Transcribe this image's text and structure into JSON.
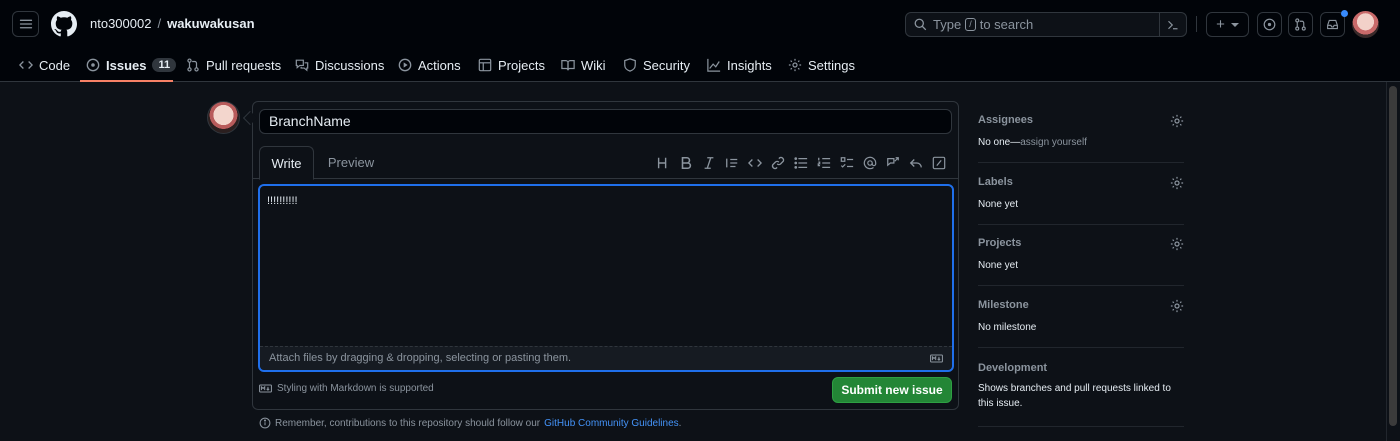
{
  "header": {
    "owner": "nto300002",
    "separator": "/",
    "repo": "wakuwakusan",
    "search_prefix": "Type",
    "search_key": "/",
    "search_suffix": "to search",
    "plus_label": "+"
  },
  "repo_nav": {
    "tabs": [
      {
        "label": "Code"
      },
      {
        "label": "Issues",
        "count": "11"
      },
      {
        "label": "Pull requests"
      },
      {
        "label": "Discussions"
      },
      {
        "label": "Actions"
      },
      {
        "label": "Projects"
      },
      {
        "label": "Wiki"
      },
      {
        "label": "Security"
      },
      {
        "label": "Insights"
      },
      {
        "label": "Settings"
      }
    ]
  },
  "issue_form": {
    "title_value": "BranchName",
    "write_tab": "Write",
    "preview_tab": "Preview",
    "body_value": "!!!!!!!!!!",
    "attach_text": "Attach files by dragging & dropping, selecting or pasting them.",
    "markdown_note": "Styling with Markdown is supported",
    "submit_label": "Submit new issue",
    "remember_text": "Remember, contributions to this repository should follow our",
    "guidelines_link": "GitHub Community Guidelines",
    "guidelines_tail": "."
  },
  "sidebar": {
    "assignees": {
      "heading": "Assignees",
      "value": "No one—",
      "link": "assign yourself"
    },
    "labels": {
      "heading": "Labels",
      "value": "None yet"
    },
    "projects": {
      "heading": "Projects",
      "value": "None yet"
    },
    "milestone": {
      "heading": "Milestone",
      "value": "No milestone"
    },
    "development": {
      "heading": "Development",
      "value": "Shows branches and pull requests linked to this issue."
    }
  },
  "colors": {
    "accent_blue": "#1f6feb",
    "submit_green": "#238636",
    "tab_underline": "#f78166"
  }
}
